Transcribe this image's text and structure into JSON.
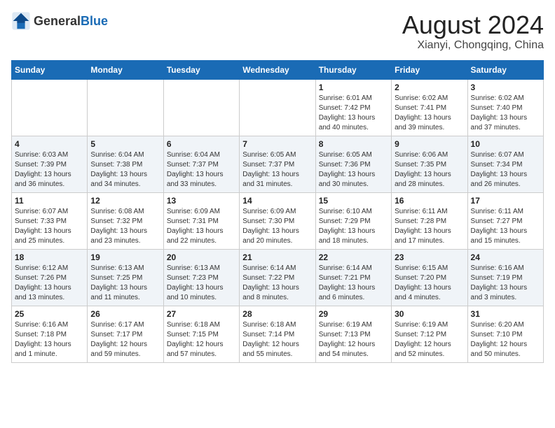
{
  "header": {
    "logo_general": "General",
    "logo_blue": "Blue",
    "month_year": "August 2024",
    "location": "Xianyi, Chongqing, China"
  },
  "weekdays": [
    "Sunday",
    "Monday",
    "Tuesday",
    "Wednesday",
    "Thursday",
    "Friday",
    "Saturday"
  ],
  "weeks": [
    [
      {
        "day": "",
        "info": ""
      },
      {
        "day": "",
        "info": ""
      },
      {
        "day": "",
        "info": ""
      },
      {
        "day": "",
        "info": ""
      },
      {
        "day": "1",
        "info": "Sunrise: 6:01 AM\nSunset: 7:42 PM\nDaylight: 13 hours\nand 40 minutes."
      },
      {
        "day": "2",
        "info": "Sunrise: 6:02 AM\nSunset: 7:41 PM\nDaylight: 13 hours\nand 39 minutes."
      },
      {
        "day": "3",
        "info": "Sunrise: 6:02 AM\nSunset: 7:40 PM\nDaylight: 13 hours\nand 37 minutes."
      }
    ],
    [
      {
        "day": "4",
        "info": "Sunrise: 6:03 AM\nSunset: 7:39 PM\nDaylight: 13 hours\nand 36 minutes."
      },
      {
        "day": "5",
        "info": "Sunrise: 6:04 AM\nSunset: 7:38 PM\nDaylight: 13 hours\nand 34 minutes."
      },
      {
        "day": "6",
        "info": "Sunrise: 6:04 AM\nSunset: 7:37 PM\nDaylight: 13 hours\nand 33 minutes."
      },
      {
        "day": "7",
        "info": "Sunrise: 6:05 AM\nSunset: 7:37 PM\nDaylight: 13 hours\nand 31 minutes."
      },
      {
        "day": "8",
        "info": "Sunrise: 6:05 AM\nSunset: 7:36 PM\nDaylight: 13 hours\nand 30 minutes."
      },
      {
        "day": "9",
        "info": "Sunrise: 6:06 AM\nSunset: 7:35 PM\nDaylight: 13 hours\nand 28 minutes."
      },
      {
        "day": "10",
        "info": "Sunrise: 6:07 AM\nSunset: 7:34 PM\nDaylight: 13 hours\nand 26 minutes."
      }
    ],
    [
      {
        "day": "11",
        "info": "Sunrise: 6:07 AM\nSunset: 7:33 PM\nDaylight: 13 hours\nand 25 minutes."
      },
      {
        "day": "12",
        "info": "Sunrise: 6:08 AM\nSunset: 7:32 PM\nDaylight: 13 hours\nand 23 minutes."
      },
      {
        "day": "13",
        "info": "Sunrise: 6:09 AM\nSunset: 7:31 PM\nDaylight: 13 hours\nand 22 minutes."
      },
      {
        "day": "14",
        "info": "Sunrise: 6:09 AM\nSunset: 7:30 PM\nDaylight: 13 hours\nand 20 minutes."
      },
      {
        "day": "15",
        "info": "Sunrise: 6:10 AM\nSunset: 7:29 PM\nDaylight: 13 hours\nand 18 minutes."
      },
      {
        "day": "16",
        "info": "Sunrise: 6:11 AM\nSunset: 7:28 PM\nDaylight: 13 hours\nand 17 minutes."
      },
      {
        "day": "17",
        "info": "Sunrise: 6:11 AM\nSunset: 7:27 PM\nDaylight: 13 hours\nand 15 minutes."
      }
    ],
    [
      {
        "day": "18",
        "info": "Sunrise: 6:12 AM\nSunset: 7:26 PM\nDaylight: 13 hours\nand 13 minutes."
      },
      {
        "day": "19",
        "info": "Sunrise: 6:13 AM\nSunset: 7:25 PM\nDaylight: 13 hours\nand 11 minutes."
      },
      {
        "day": "20",
        "info": "Sunrise: 6:13 AM\nSunset: 7:23 PM\nDaylight: 13 hours\nand 10 minutes."
      },
      {
        "day": "21",
        "info": "Sunrise: 6:14 AM\nSunset: 7:22 PM\nDaylight: 13 hours\nand 8 minutes."
      },
      {
        "day": "22",
        "info": "Sunrise: 6:14 AM\nSunset: 7:21 PM\nDaylight: 13 hours\nand 6 minutes."
      },
      {
        "day": "23",
        "info": "Sunrise: 6:15 AM\nSunset: 7:20 PM\nDaylight: 13 hours\nand 4 minutes."
      },
      {
        "day": "24",
        "info": "Sunrise: 6:16 AM\nSunset: 7:19 PM\nDaylight: 13 hours\nand 3 minutes."
      }
    ],
    [
      {
        "day": "25",
        "info": "Sunrise: 6:16 AM\nSunset: 7:18 PM\nDaylight: 13 hours\nand 1 minute."
      },
      {
        "day": "26",
        "info": "Sunrise: 6:17 AM\nSunset: 7:17 PM\nDaylight: 12 hours\nand 59 minutes."
      },
      {
        "day": "27",
        "info": "Sunrise: 6:18 AM\nSunset: 7:15 PM\nDaylight: 12 hours\nand 57 minutes."
      },
      {
        "day": "28",
        "info": "Sunrise: 6:18 AM\nSunset: 7:14 PM\nDaylight: 12 hours\nand 55 minutes."
      },
      {
        "day": "29",
        "info": "Sunrise: 6:19 AM\nSunset: 7:13 PM\nDaylight: 12 hours\nand 54 minutes."
      },
      {
        "day": "30",
        "info": "Sunrise: 6:19 AM\nSunset: 7:12 PM\nDaylight: 12 hours\nand 52 minutes."
      },
      {
        "day": "31",
        "info": "Sunrise: 6:20 AM\nSunset: 7:10 PM\nDaylight: 12 hours\nand 50 minutes."
      }
    ]
  ]
}
